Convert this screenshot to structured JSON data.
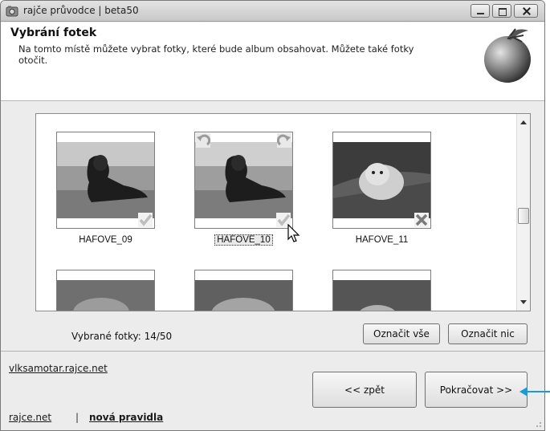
{
  "window": {
    "title": "rajče průvodce | beta50"
  },
  "header": {
    "title": "Vybrání fotek",
    "description": "Na tomto místě můžete vybrat fotky, které bude album obsahovat. Můžete také fotky otočit."
  },
  "gallery": {
    "items": [
      {
        "caption": "HAFOVE_09",
        "state": "selected"
      },
      {
        "caption": "HAFOVE_10",
        "state": "selected"
      },
      {
        "caption": "HAFOVE_11",
        "state": "deselected"
      }
    ]
  },
  "footer": {
    "selected_count": "Vybrané fotky: 14/50",
    "select_all": "Označit vše",
    "select_none": "Označit nic",
    "back": "<< zpět",
    "next": "Pokračovat >>"
  },
  "links": {
    "album": "vlksamotar.rajce.net",
    "site": "rajce.net",
    "separator": "|",
    "rules": "nová pravidla"
  },
  "colors": {
    "accent_arrow": "#1a9ad6"
  }
}
